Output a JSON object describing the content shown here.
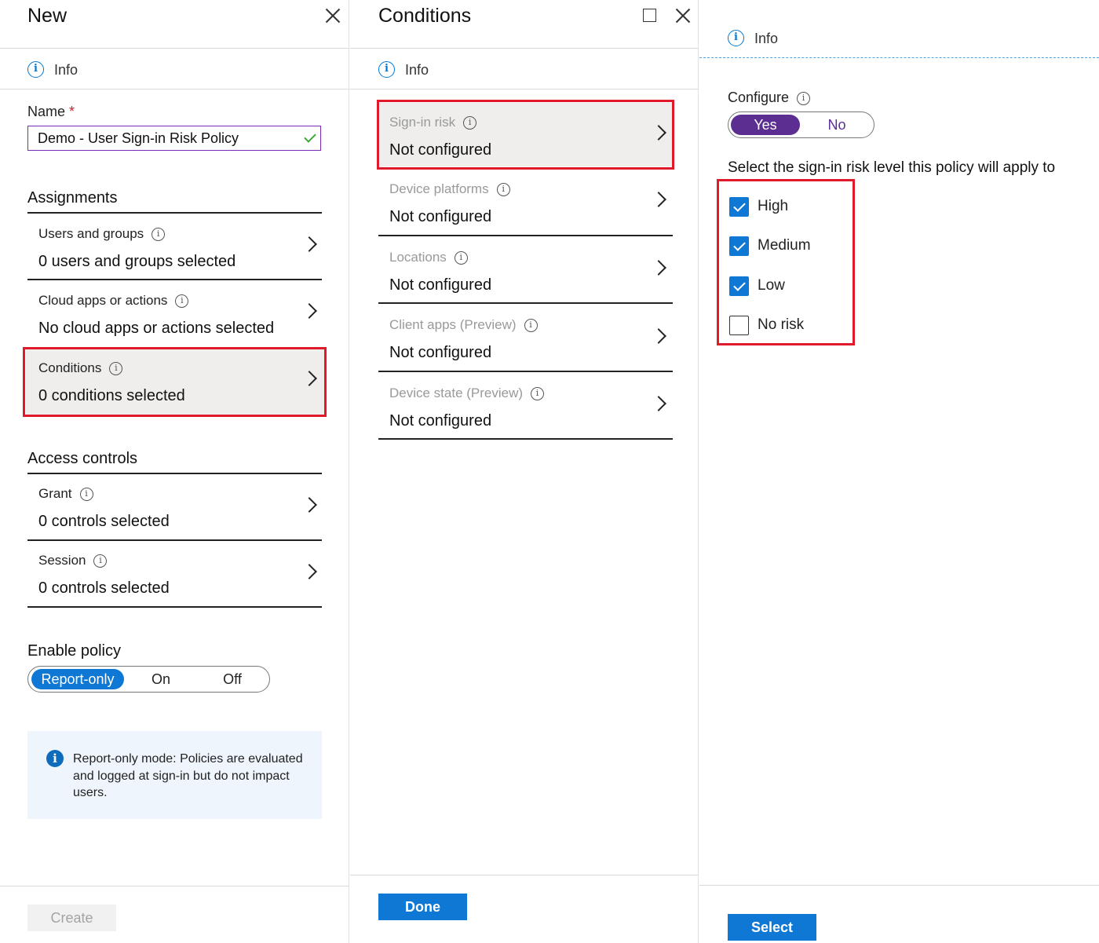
{
  "new_blade": {
    "title": "New",
    "info_label": "Info",
    "name_label": "Name",
    "required_mark": "*",
    "name_value": "Demo - User Sign-in Risk Policy",
    "assignments_heading": "Assignments",
    "assignments": [
      {
        "label": "Users and groups",
        "value": "0 users and groups selected"
      },
      {
        "label": "Cloud apps or actions",
        "value": "No cloud apps or actions selected"
      },
      {
        "label": "Conditions",
        "value": "0 conditions selected"
      }
    ],
    "access_heading": "Access controls",
    "access": [
      {
        "label": "Grant",
        "value": "0 controls selected"
      },
      {
        "label": "Session",
        "value": "0 controls selected"
      }
    ],
    "enable_heading": "Enable policy",
    "enable_options": [
      "Report-only",
      "On",
      "Off"
    ],
    "enable_selected": "Report-only",
    "notice_text": "Report-only mode: Policies are evaluated and logged at sign-in but do not impact users.",
    "create_label": "Create"
  },
  "conditions_blade": {
    "title": "Conditions",
    "info_label": "Info",
    "items": [
      {
        "label": "Sign-in risk",
        "value": "Not configured"
      },
      {
        "label": "Device platforms",
        "value": "Not configured"
      },
      {
        "label": "Locations",
        "value": "Not configured"
      },
      {
        "label": "Client apps (Preview)",
        "value": "Not configured"
      },
      {
        "label": "Device state (Preview)",
        "value": "Not configured"
      }
    ],
    "done_label": "Done"
  },
  "risk_blade": {
    "info_label": "Info",
    "configure_label": "Configure",
    "configure_options": [
      "Yes",
      "No"
    ],
    "configure_selected": "Yes",
    "instruction": "Select the sign-in risk level this policy will apply to",
    "levels": [
      {
        "label": "High",
        "checked": true
      },
      {
        "label": "Medium",
        "checked": true
      },
      {
        "label": "Low",
        "checked": true
      },
      {
        "label": "No risk",
        "checked": false
      }
    ],
    "select_label": "Select"
  },
  "colors": {
    "accent_blue": "#0f78d4",
    "configure_purple": "#5c2e91",
    "highlight_red": "#e01a2b",
    "input_border_purple": "#7a2bb5"
  }
}
